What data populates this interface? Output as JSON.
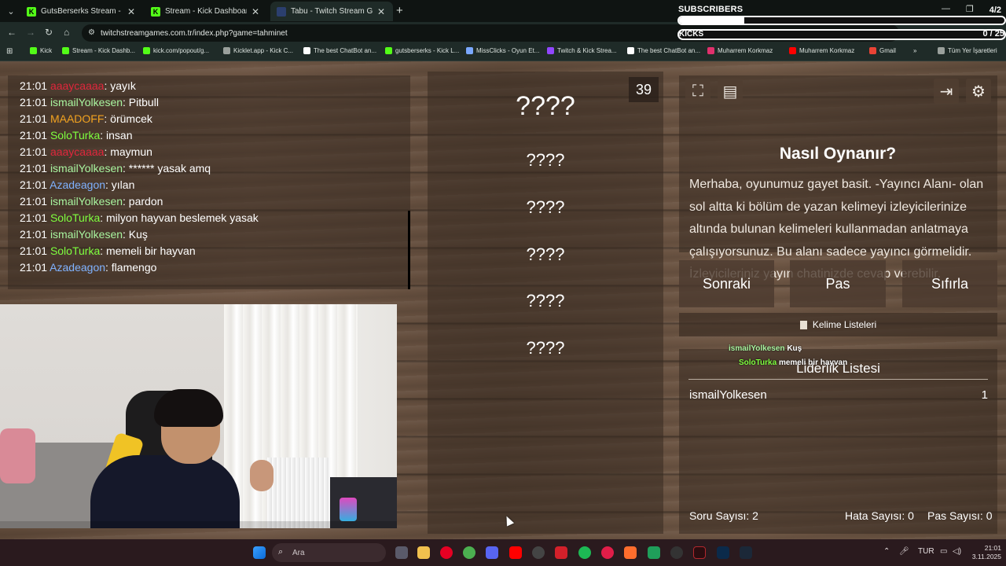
{
  "browser": {
    "tabs": [
      {
        "title": "GutsBerserks Stream - Watch L",
        "favicon": "kick-icon",
        "active": false
      },
      {
        "title": "Stream - Kick Dashboard",
        "favicon": "kick-icon",
        "active": false
      },
      {
        "title": "Tabu - Twitch Stream Games",
        "favicon": "twitch-games-icon",
        "active": true
      }
    ],
    "url": "twitchstreamgames.com.tr/index.php?game=tahminet",
    "bookmarks": [
      {
        "label": "Kick",
        "color": "#53fc18"
      },
      {
        "label": "Stream - Kick Dashb...",
        "color": "#53fc18"
      },
      {
        "label": "kick.com/popout/g...",
        "color": "#53fc18"
      },
      {
        "label": "Kicklet.app - Kick C...",
        "color": "#9aa09c"
      },
      {
        "label": "The best ChatBot an...",
        "color": "#ffffff"
      },
      {
        "label": "gutsberserks - Kick L...",
        "color": "#53fc18"
      },
      {
        "label": "MissClicks - Oyun Et...",
        "color": "#7aa8ff"
      },
      {
        "label": "Twitch & Kick Strea...",
        "color": "#9146ff"
      },
      {
        "label": "The best ChatBot an...",
        "color": "#ffffff"
      },
      {
        "label": "Muharrem Korkmaz",
        "color": "#e1306c"
      },
      {
        "label": "Muharrem Korkmaz",
        "color": "#ff0000"
      },
      {
        "label": "Gmail",
        "color": "#ea4335"
      },
      {
        "label": "Tüm Yer İşaretleri",
        "color": "#9aa09c"
      }
    ]
  },
  "overlay": {
    "subscribers_label": "SUBSCRIBERS",
    "subscribers_count": "4/2",
    "subscribers_progress": 0.2,
    "kicks_label": "KICKS",
    "kicks_count": "0 / 25",
    "kicks_progress": 0
  },
  "chat": [
    {
      "time": "21:01",
      "user": "aaaycaaaa",
      "color": "#e0263c",
      "text": ": yayık"
    },
    {
      "time": "21:01",
      "user": "ismailYolkesen",
      "color": "#a9f5a0",
      "text": ": Pitbull"
    },
    {
      "time": "21:01",
      "user": "MAADOFF",
      "color": "#f2a21f",
      "text": ": örümcek"
    },
    {
      "time": "21:01",
      "user": "SoloTurka",
      "color": "#7fff3f",
      "text": ": insan"
    },
    {
      "time": "21:01",
      "user": "aaaycaaaa",
      "color": "#e0263c",
      "text": ": maymun"
    },
    {
      "time": "21:01",
      "user": "ismailYolkesen",
      "color": "#a9f5a0",
      "text": ": ****** yasak amq"
    },
    {
      "time": "21:01",
      "user": "Azadeagon",
      "color": "#7fb2ff",
      "text": ": yılan"
    },
    {
      "time": "21:01",
      "user": "ismailYolkesen",
      "color": "#a9f5a0",
      "text": ": pardon"
    },
    {
      "time": "21:01",
      "user": "SoloTurka",
      "color": "#7fff3f",
      "text": ": milyon hayvan beslemek yasak"
    },
    {
      "time": "21:01",
      "user": "ismailYolkesen",
      "color": "#a9f5a0",
      "text": ": Kuş"
    },
    {
      "time": "21:01",
      "user": "SoloTurka",
      "color": "#7fff3f",
      "text": ": memeli bir hayvan"
    },
    {
      "time": "21:01",
      "user": "Azadeagon",
      "color": "#7fb2ff",
      "text": ": flamengo"
    }
  ],
  "game": {
    "timer": "39",
    "main_word": "????",
    "taboo_words": [
      "????",
      "????",
      "????",
      "????",
      "????"
    ],
    "how_title": "Nasıl Oynanır?",
    "how_text": "Merhaba, oyunumuz gayet basit. -Yayıncı Alanı- olan sol altta ki bölüm de yazan kelimeyi izleyicilerinize altında bulunan kelimeleri kullanmadan anlatmaya çalışıyorsunuz. Bu alanı sadece yayıncı görmelidir. İzleyicileriniz yayın chatinizde cevap verebilir.",
    "buttons": {
      "next": "Sonraki",
      "pass": "Pas",
      "reset": "Sıfırla"
    },
    "word_lists": "Kelime Listeleri",
    "leaderboard_title": "Liderlik Listesi",
    "leaderboard": [
      {
        "name": "ismailYolkesen",
        "score": "1"
      }
    ],
    "popups": [
      {
        "user": "ismailYolkesen",
        "text": "Kuş"
      },
      {
        "user": "SoloTurka",
        "text": "memeli bir hayvan"
      }
    ],
    "stats": {
      "questions": "Soru Sayısı: 2",
      "errors": "Hata Sayısı: 0",
      "passes": "Pas Sayısı: 0"
    }
  },
  "taskbar": {
    "search_placeholder": "Ara",
    "lang": "TUR",
    "time": "21:01",
    "date": "3.11.2025"
  }
}
